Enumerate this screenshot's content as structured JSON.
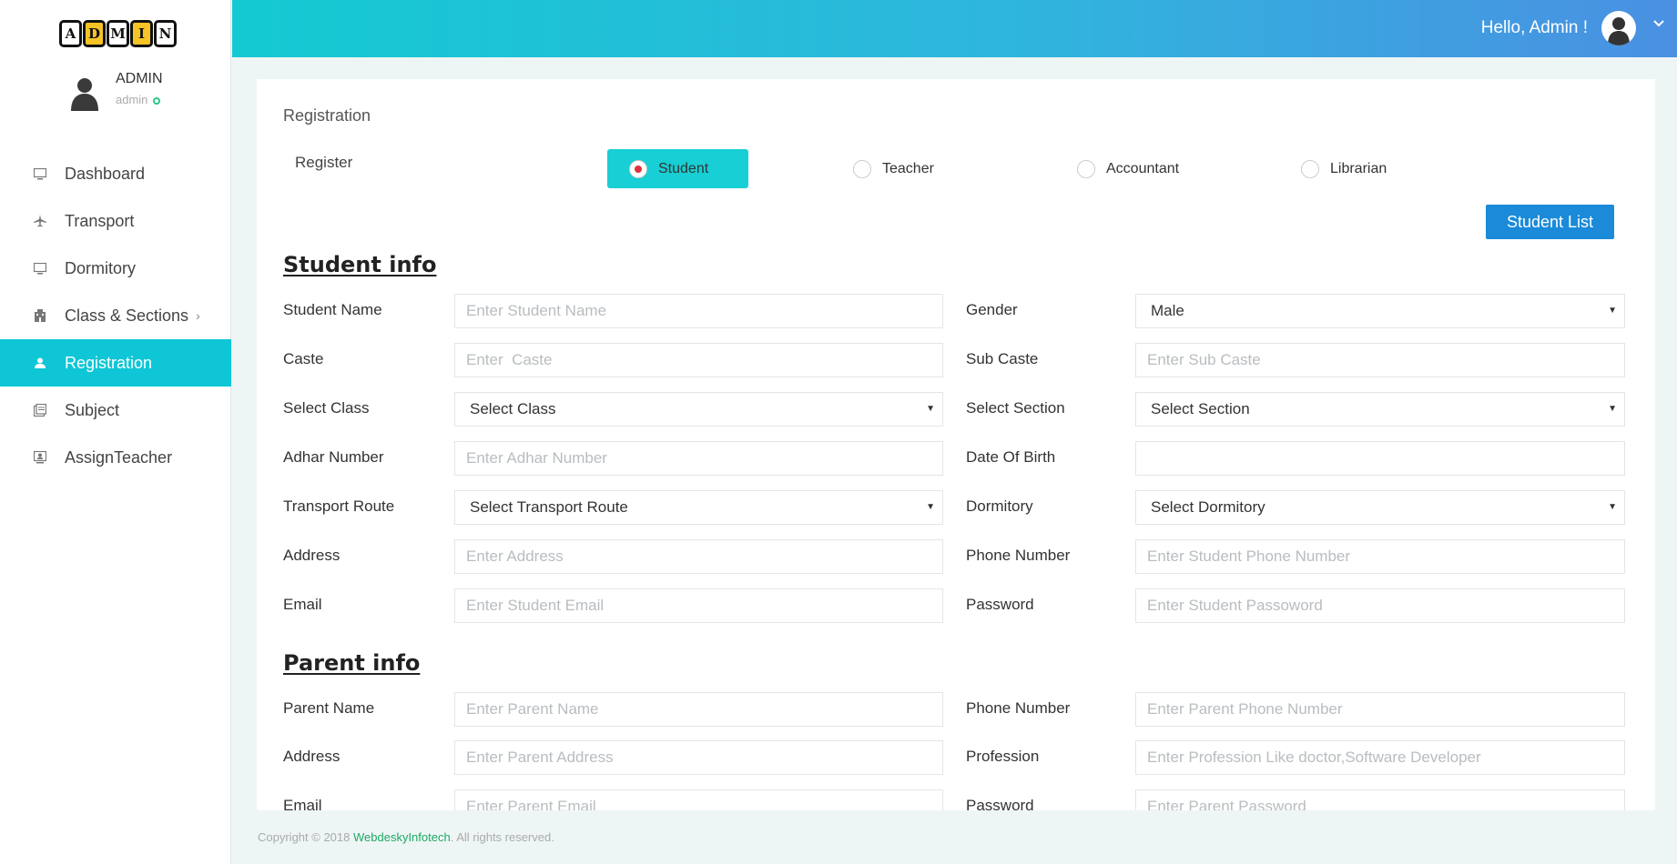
{
  "logo": {
    "letters": [
      "A",
      "D",
      "M",
      "I",
      "N"
    ]
  },
  "profile": {
    "name": "ADMIN",
    "role": "admin"
  },
  "nav": {
    "items": [
      {
        "label": "Dashboard",
        "icon": "monitor-icon"
      },
      {
        "label": "Transport",
        "icon": "airplane-icon"
      },
      {
        "label": "Dormitory",
        "icon": "monitor-icon"
      },
      {
        "label": "Class & Sections",
        "icon": "building-icon",
        "submenu": true
      },
      {
        "label": "Registration",
        "icon": "user-icon",
        "active": true
      },
      {
        "label": "Subject",
        "icon": "books-icon"
      },
      {
        "label": "AssignTeacher",
        "icon": "teacher-icon"
      }
    ]
  },
  "topbar": {
    "greeting": "Hello, Admin !"
  },
  "page": {
    "title": "Registration",
    "register_label": "Register",
    "roles": [
      "Student",
      "Teacher",
      "Accountant",
      "Librarian"
    ],
    "selected_role": "Student",
    "student_list_button": "Student List"
  },
  "student_info": {
    "title": "Student info",
    "fields": {
      "student_name": {
        "label": "Student Name",
        "placeholder": "Enter Student Name"
      },
      "gender": {
        "label": "Gender",
        "value": "Male"
      },
      "caste": {
        "label": "Caste",
        "placeholder": "Enter  Caste"
      },
      "sub_caste": {
        "label": "Sub Caste",
        "placeholder": "Enter Sub Caste"
      },
      "select_class": {
        "label": "Select Class",
        "value": "Select Class"
      },
      "select_section": {
        "label": "Select Section",
        "value": "Select Section"
      },
      "adhar": {
        "label": "Adhar Number",
        "placeholder": "Enter Adhar Number"
      },
      "dob": {
        "label": "Date Of Birth",
        "placeholder": ""
      },
      "transport": {
        "label": "Transport Route",
        "value": "Select Transport Route"
      },
      "dormitory": {
        "label": "Dormitory",
        "value": "Select Dormitory"
      },
      "address": {
        "label": "Address",
        "placeholder": "Enter Address"
      },
      "phone": {
        "label": "Phone Number",
        "placeholder": "Enter Student Phone Number"
      },
      "email": {
        "label": "Email",
        "placeholder": "Enter Student Email"
      },
      "password": {
        "label": "Password",
        "placeholder": "Enter Student Passoword"
      }
    }
  },
  "parent_info": {
    "title": "Parent info",
    "fields": {
      "parent_name": {
        "label": "Parent Name",
        "placeholder": "Enter Parent Name"
      },
      "phone": {
        "label": "Phone Number",
        "placeholder": "Enter Parent Phone Number"
      },
      "address": {
        "label": "Address",
        "placeholder": "Enter Parent Address"
      },
      "profession": {
        "label": "Profession",
        "placeholder": "Enter Profession Like doctor,Software Developer"
      },
      "email": {
        "label": "Email",
        "placeholder": "Enter Parent Email"
      },
      "password": {
        "label": "Password",
        "placeholder": "Enter Parent Password"
      }
    }
  },
  "footer": {
    "prefix": "Copyright © 2018 ",
    "company": "WebdeskyInfotech",
    "suffix": ". All rights reserved."
  },
  "colors": {
    "accent": "#0ec6d6",
    "button_blue": "#1a8ad9",
    "radio_dot": "#e0303c",
    "online": "#2bc48a",
    "footer_link": "#1ea965"
  }
}
